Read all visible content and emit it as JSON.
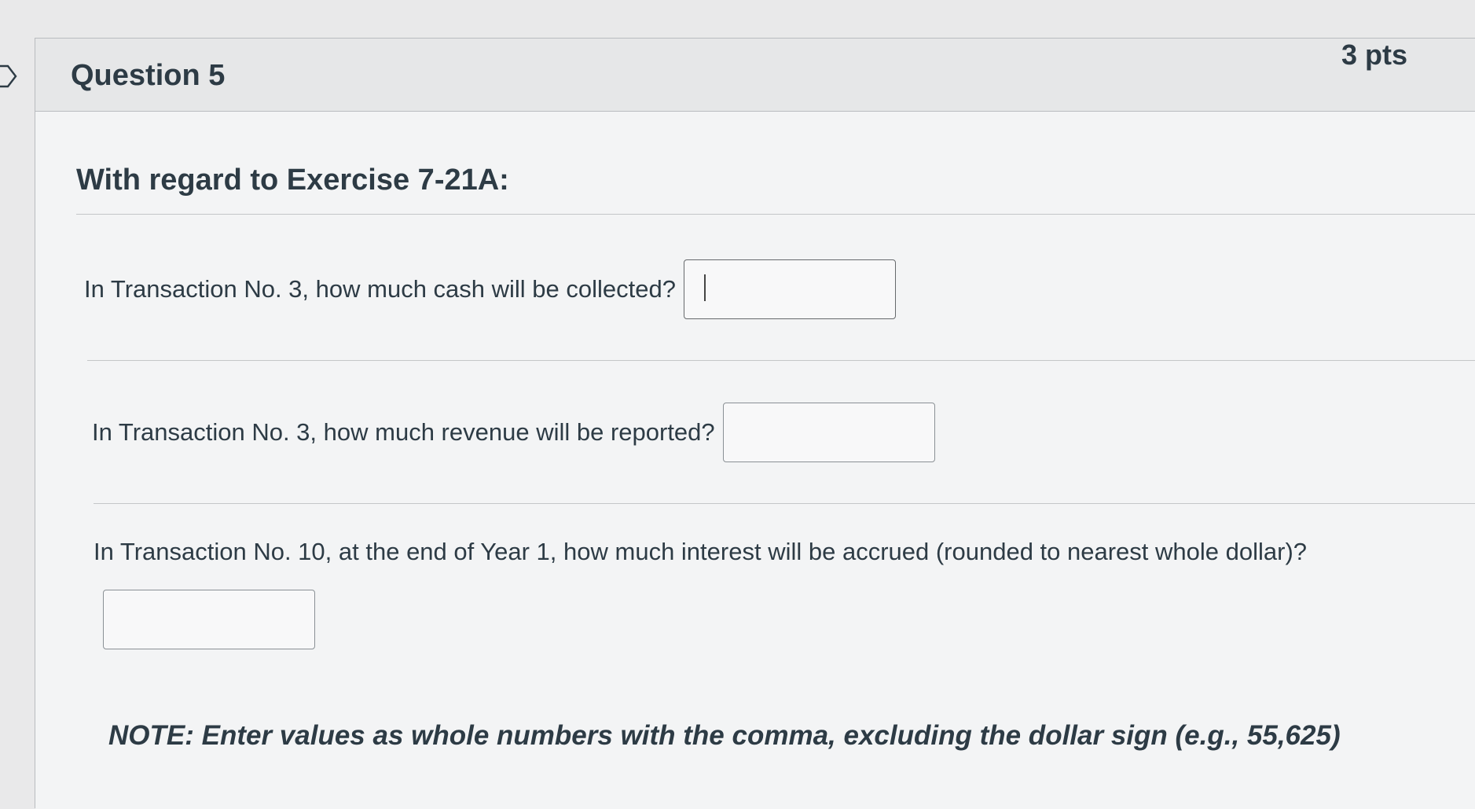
{
  "question": {
    "title": "Question 5",
    "points": "3 pts",
    "intro": "With regard to Exercise 7-21A:",
    "items": [
      {
        "label": "In Transaction No. 3, how much cash will be collected?",
        "value": ""
      },
      {
        "label": "In Transaction No. 3, how much revenue will be reported?",
        "value": ""
      },
      {
        "label": "In Transaction No. 10, at the end of Year 1, how much interest will be accrued (rounded to nearest whole dollar)?",
        "value": ""
      }
    ],
    "note": "NOTE: Enter values as whole numbers with the comma, excluding the dollar sign (e.g., 55,625)"
  },
  "icons": {
    "flag": "bookmark-flag-icon"
  }
}
